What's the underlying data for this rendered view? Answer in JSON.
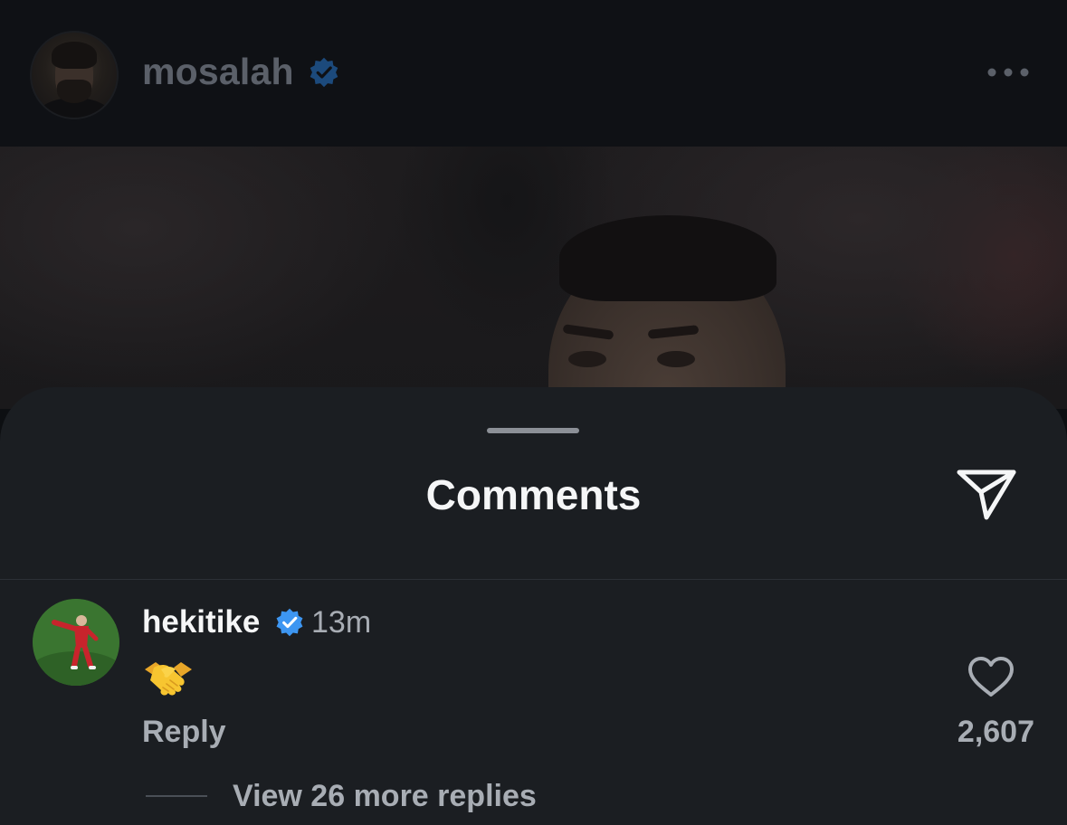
{
  "post": {
    "username": "mosalah",
    "verified": true,
    "more_icon": "more-horizontal-icon"
  },
  "comments_sheet": {
    "title": "Comments",
    "share_icon": "send-icon"
  },
  "comment": {
    "username": "hekitike",
    "verified": true,
    "time": "13m",
    "text_emoji": "handshake",
    "reply_label": "Reply",
    "like_icon": "heart-outline-icon",
    "like_count": "2,607",
    "view_replies_label": "View 26 more replies"
  },
  "colors": {
    "sheet_background": "#1b1e22",
    "verified_blue": "#3d96f2",
    "secondary_text": "#a8adb4"
  }
}
